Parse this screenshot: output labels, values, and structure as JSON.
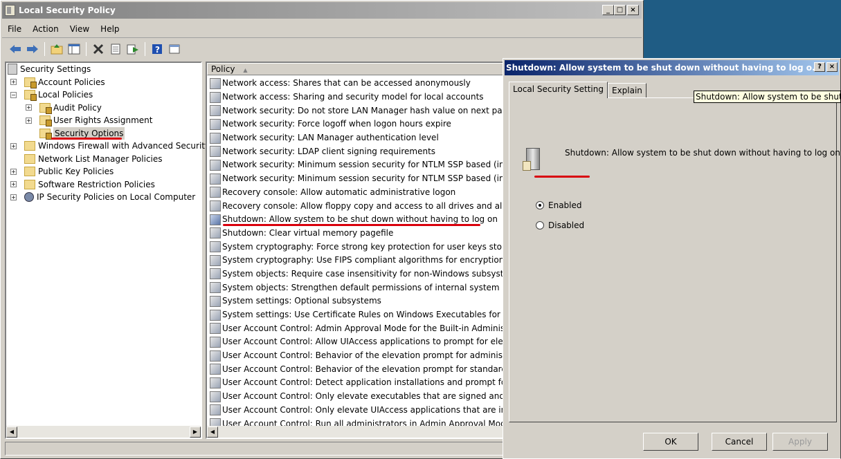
{
  "main_window": {
    "title": "Local Security Policy",
    "caption_buttons": [
      "_",
      "□",
      "×"
    ]
  },
  "menu": [
    "File",
    "Action",
    "View",
    "Help"
  ],
  "toolbar": {
    "icons": [
      "back-icon",
      "forward-icon",
      "up-folder-icon",
      "show-hide-tree-icon",
      "delete-icon",
      "properties-icon",
      "export-icon",
      "help-icon",
      "console-icon"
    ]
  },
  "tree": {
    "root": "Security Settings",
    "account_policies": "Account Policies",
    "local_policies": "Local Policies",
    "audit_policy": "Audit Policy",
    "user_rights": "User Rights Assignment",
    "security_options": "Security Options",
    "windows_firewall": "Windows Firewall with Advanced Security",
    "network_list": "Network List Manager Policies",
    "public_key": "Public Key Policies",
    "software_restriction": "Software Restriction Policies",
    "ip_security": "IP Security Policies on Local Computer",
    "expander_plus": "+",
    "expander_minus": "−"
  },
  "policy_list": {
    "column_header": "Policy",
    "sort_indicator": "▲",
    "rows": [
      "Network access: Shares that can be accessed anonymously",
      "Network access: Sharing and security model for local accounts",
      "Network security: Do not store LAN Manager hash value on next passwo",
      "Network security: Force logoff when logon hours expire",
      "Network security: LAN Manager authentication level",
      "Network security: LDAP client signing requirements",
      "Network security: Minimum session security for NTLM SSP based (includin",
      "Network security: Minimum session security for NTLM SSP based (includin",
      "Recovery console: Allow automatic administrative logon",
      "Recovery console: Allow floppy copy and access to all drives and all fold",
      "Shutdown: Allow system to be shut down without having to log on",
      "Shutdown: Clear virtual memory pagefile",
      "System cryptography: Force strong key protection for user keys stored",
      "System cryptography: Use FIPS compliant algorithms for encryption, has",
      "System objects: Require case insensitivity for non-Windows subsystems",
      "System objects: Strengthen default permissions of internal system objec",
      "System settings: Optional subsystems",
      "System settings: Use Certificate Rules on Windows Executables for Soft",
      "User Account Control: Admin Approval Mode for the Built-in Administratc",
      "User Account Control: Allow UIAccess applications to prompt for elevatic",
      "User Account Control: Behavior of the elevation prompt for administrato",
      "User Account Control: Behavior of the elevation prompt for standard use",
      "User Account Control: Detect application installations and prompt for ele",
      "User Account Control: Only elevate executables that are signed and val",
      "User Account Control: Only elevate UIAccess applications that are instal",
      "User Account Control: Run all administrators in Admin Approval Mode"
    ]
  },
  "dialog": {
    "title": "Shutdown: Allow system to be shut down without having to log o...",
    "help_button": "?",
    "close_button": "×",
    "tabs": [
      "Local Security Setting",
      "Explain"
    ],
    "tooltip": "Shutdown: Allow system to be shut d",
    "description": "Shutdown: Allow system to be shut down without having to log on",
    "enabled_label": "Enabled",
    "disabled_label": "Disabled",
    "ok": "OK",
    "cancel": "Cancel",
    "apply": "Apply"
  },
  "annotation_color": "#d9000c"
}
